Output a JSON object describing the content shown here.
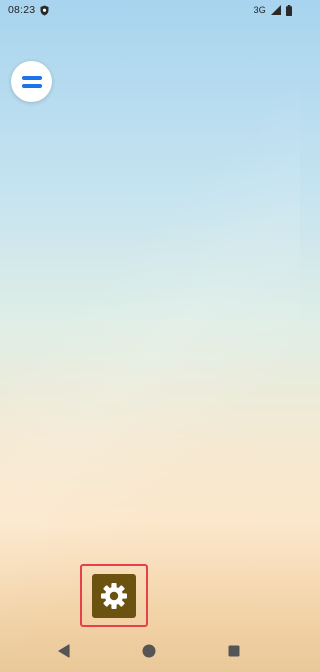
{
  "status_bar": {
    "time": "08:23",
    "network_label": "3G",
    "left_icons": [
      "shield-icon"
    ],
    "right_icons": [
      "signal-icon",
      "battery-icon"
    ]
  },
  "home": {
    "drawer_button_icon": "drawer-handle-icon",
    "dock_apps": [
      {
        "icon": "gear-icon",
        "app": "Settings",
        "highlighted": true
      }
    ]
  },
  "nav_bar": {
    "buttons": [
      "back-icon",
      "home-icon",
      "recents-icon"
    ]
  },
  "colors": {
    "accent_blue": "#1a73e8",
    "settings_tile": "#6b5210",
    "highlight_border": "#e8404a",
    "nav_icon": "#555555"
  }
}
